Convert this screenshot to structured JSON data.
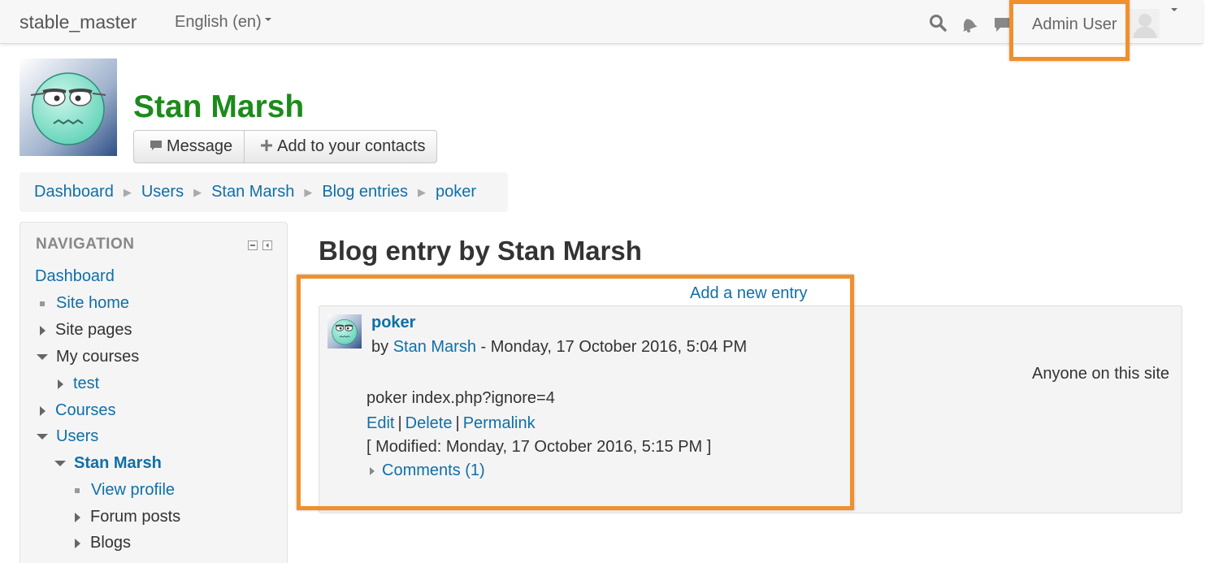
{
  "navbar": {
    "brand": "stable_master",
    "language": "English (en)",
    "user_name": "Admin User",
    "icons": [
      "search-icon",
      "bell-icon",
      "chat-icon"
    ]
  },
  "header": {
    "name": "Stan Marsh",
    "buttons": {
      "message": "Message",
      "add_contact": "Add to your contacts"
    }
  },
  "breadcrumb": [
    "Dashboard",
    "Users",
    "Stan Marsh",
    "Blog entries",
    "poker"
  ],
  "navigation": {
    "title": "NAVIGATION",
    "items": [
      {
        "label": "Dashboard"
      },
      {
        "label": "Site home"
      },
      {
        "label": "Site pages"
      },
      {
        "label": "My courses"
      },
      {
        "label": "test"
      },
      {
        "label": "Courses"
      },
      {
        "label": "Users"
      },
      {
        "label": "Stan Marsh"
      },
      {
        "label": "View profile"
      },
      {
        "label": "Forum posts"
      },
      {
        "label": "Blogs"
      }
    ]
  },
  "main": {
    "title": "Blog entry by Stan Marsh",
    "add_entry": "Add a new entry",
    "entry": {
      "title": "poker",
      "by_prefix": "by",
      "author": "Stan Marsh",
      "date": "- Monday, 17 October 2016, 5:04 PM",
      "audience": "Anyone on this site",
      "body": "poker index.php?ignore=4",
      "actions": [
        "Edit",
        "Delete",
        "Permalink"
      ],
      "modified": "[ Modified: Monday, 17 October 2016, 5:15 PM ]",
      "comments": "Comments (1)"
    }
  },
  "colors": {
    "highlight": "#f0902d",
    "link": "#0f6fa8",
    "name_green": "#1c8b1c"
  }
}
